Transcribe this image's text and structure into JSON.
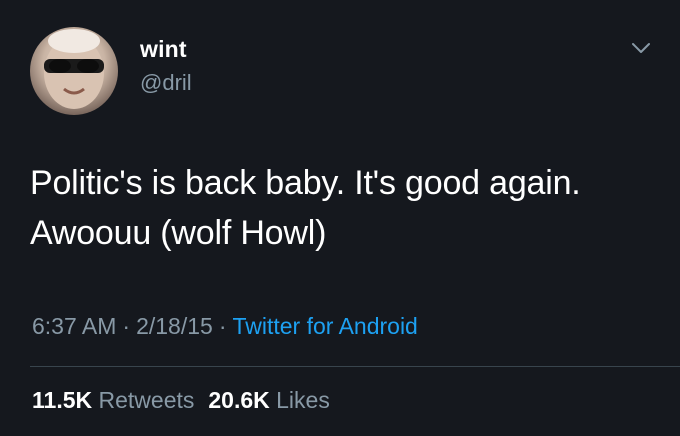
{
  "tweet": {
    "author": {
      "display_name": "wint",
      "handle": "@dril"
    },
    "text_line1": "Politic's is back baby. It's good again.",
    "text_line2": "Awoouu (wolf Howl)",
    "time": "6:37 AM",
    "date": "2/18/15",
    "separator": "·",
    "source": "Twitter for Android",
    "retweets_count": "11.5K",
    "retweets_label": "Retweets",
    "likes_count": "20.6K",
    "likes_label": "Likes",
    "menu_icon": "chevron-down-icon",
    "avatar_icon": "profile-photo"
  },
  "colors": {
    "background": "#15181e",
    "primary_text": "#ffffff",
    "secondary_text": "#8899a6",
    "link": "#1da1f2",
    "divider": "#38444d"
  }
}
